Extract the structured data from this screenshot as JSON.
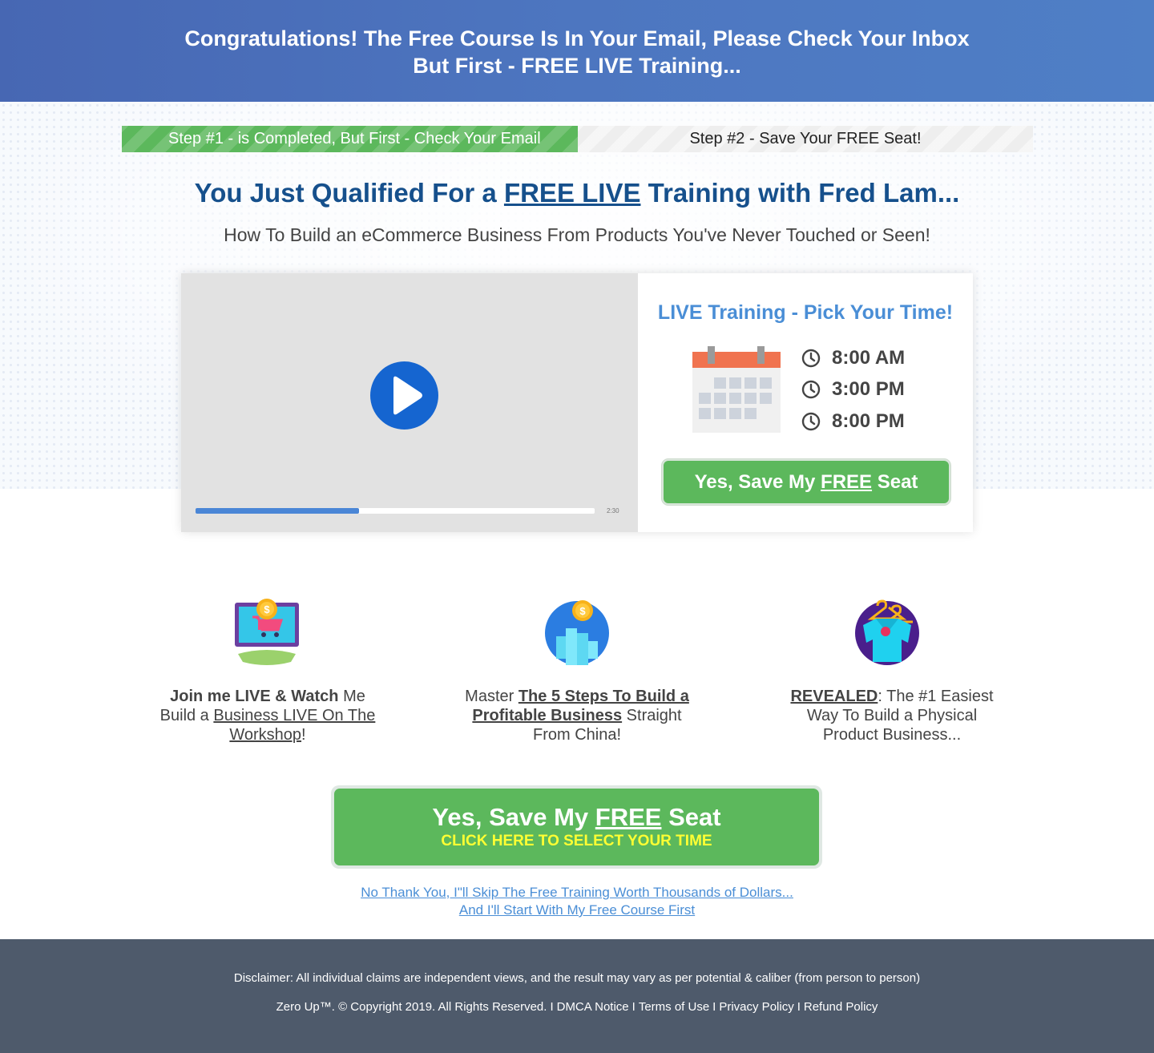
{
  "banner": {
    "line1": "Congratulations! The Free Course Is In Your Email, Please Check Your Inbox",
    "line2": "But First - FREE LIVE Training..."
  },
  "progress": {
    "step1": "Step #1 - is Completed, But First - Check Your Email",
    "step2": "Step #2 - Save Your FREE Seat!"
  },
  "headline": {
    "pre": "You Just Qualified For a ",
    "underlined": "FREE LIVE",
    "post": " Training with Fred Lam..."
  },
  "subheadline": "How To Build an eCommerce Business From Products You've Never Touched or Seen!",
  "video": {
    "time": "2:30",
    "progress_fraction": 0.41
  },
  "schedule": {
    "title": "LIVE Training - Pick Your Time!",
    "times": [
      "8:00 AM",
      "3:00 PM",
      "8:00 PM"
    ],
    "cta_pre": "Yes, Save My ",
    "cta_underlined": "FREE",
    "cta_post": " Seat"
  },
  "features": [
    {
      "icon": "shopping-cart-monitor-icon",
      "bold": "Join me LIVE & Watch",
      "text1": " Me Build a ",
      "underlined": "Business LIVE On The Workshop",
      "text2": "!"
    },
    {
      "icon": "growth-chart-coin-icon",
      "text1": "Master ",
      "bold_underlined": "The 5 Steps To Build a Profitable Business",
      "text2": " Straight From China!"
    },
    {
      "icon": "shirt-hanger-icon",
      "bold_underlined": "REVEALED",
      "text1": ": The #1 Easiest Way To Build a Physical Product Business..."
    }
  ],
  "big_cta": {
    "pre": "Yes, Save My ",
    "underlined": "FREE",
    "post": " Seat",
    "subline": "CLICK HERE TO SELECT YOUR TIME"
  },
  "no_thanks": {
    "line1": "No Thank You, I\"ll Skip The Free Training Worth Thousands of Dollars...",
    "line2": "And I'll Start With My Free Course First"
  },
  "footer": {
    "disclaimer": "Disclaimer: All individual claims are independent views, and the result may vary as per potential & caliber  (from person to person)",
    "copyright": "Zero Up™. © Copyright 2019. All Rights Reserved.",
    "separator": "I",
    "links": [
      "DMCA Notice",
      "Terms of Use",
      "Privacy Policy",
      "Refund Policy"
    ]
  },
  "colors": {
    "banner": "#4b6fba",
    "green": "#5cb85c",
    "headline_blue": "#16508c",
    "link_blue": "#4a8ed6",
    "play_blue": "#1565d0",
    "cta_yellow": "#ffff33",
    "footer": "#4e5a6b"
  }
}
